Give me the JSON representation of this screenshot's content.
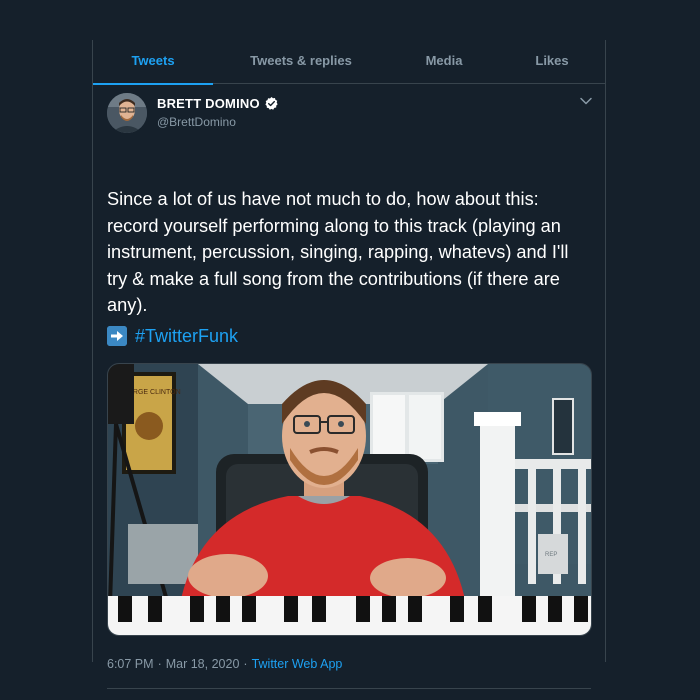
{
  "tabs": [
    {
      "label": "Tweets",
      "active": true
    },
    {
      "label": "Tweets & replies",
      "active": false
    },
    {
      "label": "Media",
      "active": false
    },
    {
      "label": "Likes",
      "active": false
    }
  ],
  "tweet": {
    "display_name": "BRETT DOMINO",
    "verified": true,
    "handle": "@BrettDomino",
    "text": "Since a lot of us have not much to do, how about this:\nrecord yourself performing along to this track (playing an\ninstrument, percussion, singing, rapping, whatevs) and I'll\ntry & make a full song from the contributions (if there are\nany).",
    "hashtag_emoji": "right-arrow-emoji",
    "hashtag": "#TwitterFunk",
    "media": {
      "type": "video-thumbnail",
      "poster_text": "GEORGE CLINTON",
      "ghost_label": "REP"
    },
    "time": "6:07 PM",
    "separator": "·",
    "date": "Mar 18, 2020",
    "source": "Twitter Web App"
  },
  "colors": {
    "background": "#15202b",
    "border": "#38444d",
    "accent": "#1da1f2",
    "secondary_text": "#8899a6",
    "primary_text": "#ffffff"
  },
  "icons": {
    "verified": "verified-badge-icon",
    "more": "chevron-down-icon"
  }
}
